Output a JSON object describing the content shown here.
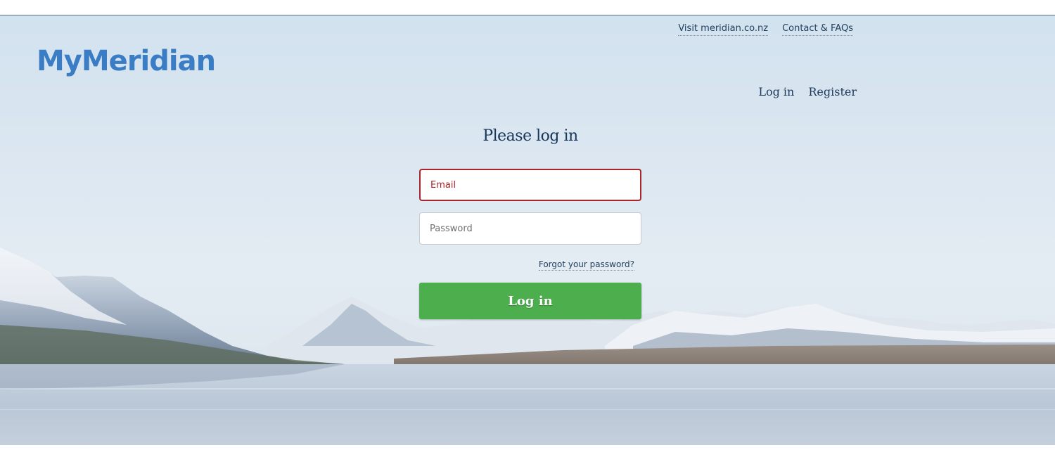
{
  "brand": {
    "logo_text": "MyMeridian",
    "accent_color": "#3b7dc4"
  },
  "top_nav": {
    "visit_link": "Visit meridian.co.nz",
    "contact_link": "Contact & FAQs"
  },
  "auth_nav": {
    "login_link": "Log in",
    "register_link": "Register"
  },
  "login_form": {
    "title": "Please log in",
    "email_placeholder": "Email",
    "email_value": "",
    "email_error_color": "#a8252b",
    "password_placeholder": "Password",
    "password_value": "",
    "forgot_link": "Forgot your password?",
    "submit_label": "Log in",
    "submit_color": "#4cae4c"
  },
  "background": {
    "icon": "mountain-lake-image"
  }
}
